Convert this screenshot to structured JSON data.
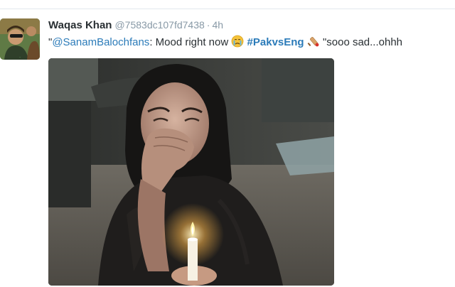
{
  "tweet": {
    "fullname": "Waqas Khan",
    "handle": "@7583dc107fd7438",
    "separator": "·",
    "time": "4h",
    "text_prefix": "\"",
    "mention": "@SanamBalochfans",
    "text_middle": ": Mood right now",
    "hashtag": "#PakvsEng",
    "text_suffix": "\"sooo sad...ohhh",
    "emoji_1": "crying-face-icon",
    "emoji_2": "cricket-bat-icon"
  },
  "media": {
    "alt_subject": "photo-woman-crying-with-candle"
  },
  "colors": {
    "link": "#2b7bb9",
    "muted": "#8899a6",
    "text": "#292f33"
  }
}
